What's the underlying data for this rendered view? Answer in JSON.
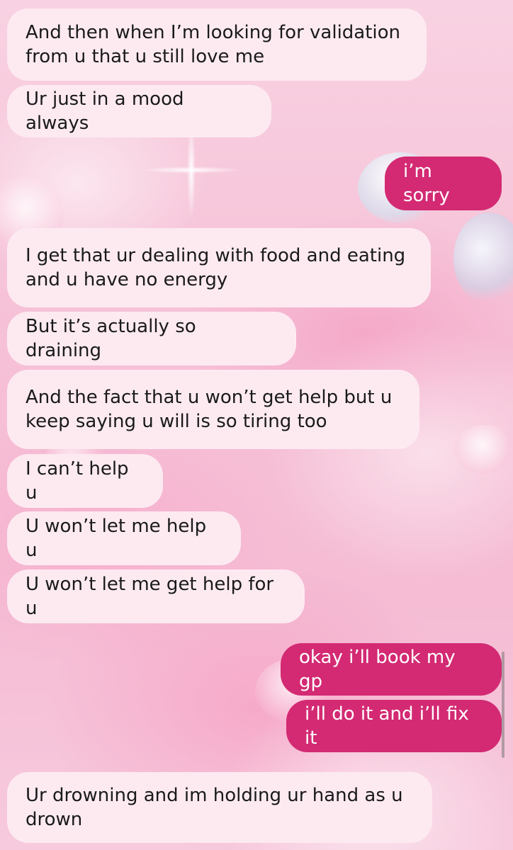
{
  "conversation": {
    "messages": [
      {
        "from": "them",
        "text": "And then when I’m looking for validation\nfrom u that u still love me"
      },
      {
        "from": "them",
        "text": "Ur just in a mood always"
      },
      {
        "from": "me",
        "text": "i’m sorry"
      },
      {
        "from": "them",
        "text": "I get that ur dealing with food and eating\nand u have no energy"
      },
      {
        "from": "them",
        "text": "But it’s actually so draining"
      },
      {
        "from": "them",
        "text": "And the fact that u won’t get help but u\nkeep saying u will is so tiring too"
      },
      {
        "from": "them",
        "text": "I can’t help u"
      },
      {
        "from": "them",
        "text": "U won’t let me help u"
      },
      {
        "from": "them",
        "text": "U won’t let me get help for u"
      },
      {
        "from": "me",
        "text": "okay i’ll book my gp"
      },
      {
        "from": "me",
        "text": "i’ll do it and i’ll fix it"
      },
      {
        "from": "them",
        "text": "Ur drowning and im holding ur hand as u\ndrown"
      }
    ]
  },
  "colors": {
    "incoming_bubble": "#fdeaf1",
    "outgoing_bubble": "#d32a73",
    "incoming_text": "#1a1a1a",
    "outgoing_text": "#ffffff"
  }
}
